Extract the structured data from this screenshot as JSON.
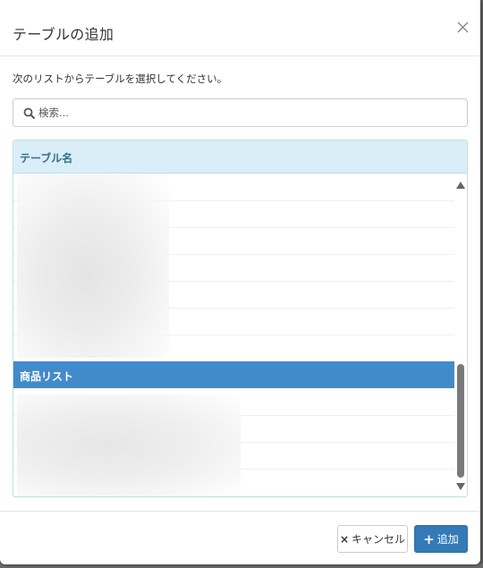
{
  "dialog": {
    "title": "テーブルの追加",
    "instruction": "次のリストからテーブルを選択してください。"
  },
  "search": {
    "placeholder": "検索...",
    "value": ""
  },
  "table": {
    "column_header": "テーブル名",
    "selected_row": "商品リスト"
  },
  "footer": {
    "cancel_icon": "×",
    "cancel_label": "キャンセル",
    "add_icon": "+",
    "add_label": "追加"
  },
  "icons": {
    "close": "close-icon",
    "search": "search-icon",
    "scroll_up": "triangle-up-icon",
    "scroll_down": "triangle-down-icon"
  },
  "colors": {
    "header_bg": "#daeef8",
    "header_text": "#31708f",
    "selected_row": "#428bca",
    "primary_button": "#337ab7"
  }
}
